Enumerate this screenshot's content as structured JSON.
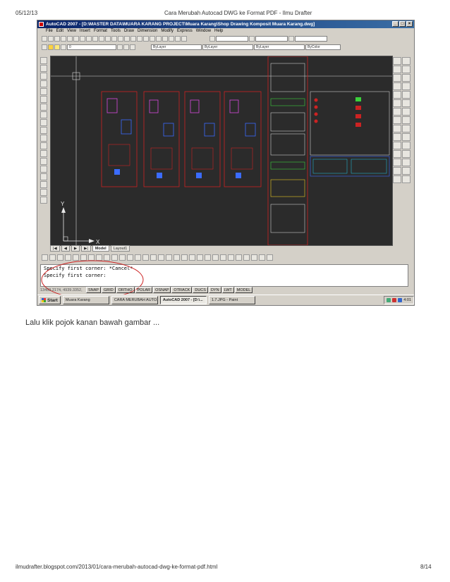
{
  "page": {
    "date": "05/12/13",
    "title": "Cara Merubah Autocad DWG ke Format PDF - Ilmu Drafter",
    "caption": "Lalu klik pojok kanan bawah gambar ...",
    "url": "ilmudrafter.blogspot.com/2013/01/cara-merubah-autocad-dwg-ke-format-pdf.html",
    "page_number": "8/14"
  },
  "screenshot": {
    "window_title": "AutoCAD 2007 - [D:\\MASTER DATA\\MUARA KARANG PROJECT\\Muara Karang\\Shop Drawing Komposit Muara Karang.dwg]",
    "menu": [
      "File",
      "Edit",
      "View",
      "Insert",
      "Format",
      "Tools",
      "Draw",
      "Dimension",
      "Modify",
      "Express",
      "Window",
      "Help"
    ],
    "layer_combo": "0",
    "bylayer_1": "ByLayer",
    "bylayer_2": "ByLayer",
    "bylayer_3": "ByLayer",
    "bycolor": "ByColor",
    "layout_tabs": [
      "Model",
      "Layout1"
    ],
    "axis_y": "Y",
    "axis_x": "X",
    "command_lines": [
      "Specify first corner: *Cancel*",
      "Specify first corner:"
    ],
    "coordinates": "13459.2174, 4939.3352, 0.0000",
    "status_buttons": [
      "SNAP",
      "GRID",
      "ORTHO",
      "POLAR",
      "OSNAP",
      "OTRACK",
      "DUCS",
      "DYN",
      "LWT",
      "MODEL"
    ],
    "start": "Start",
    "tasks": [
      "Muara Karang",
      "CARA MERUBAH AUTO...",
      "AutoCAD 2007 - [D:\\...",
      "1.7.JPG - Paint"
    ],
    "clock": "4:01"
  },
  "colors": {
    "canvas": "#2b2b2b",
    "titlebar": "#0a246a",
    "highlight": "#cc2222"
  }
}
